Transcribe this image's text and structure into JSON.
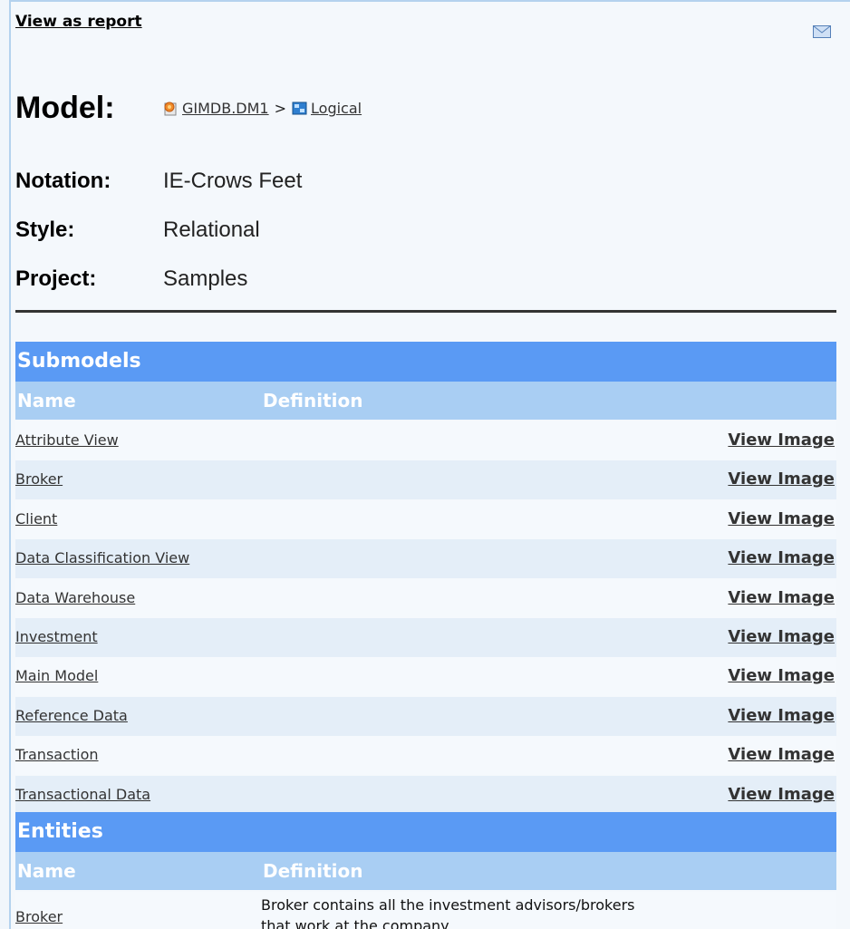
{
  "header": {
    "view_as_report": "View as report",
    "mail_icon": "mail-icon"
  },
  "model": {
    "label": "Model:",
    "breadcrumb": {
      "model_link": "GIMDB.DM1",
      "separator": ">",
      "submodel_link": "Logical"
    }
  },
  "properties": {
    "notation": {
      "label": "Notation:",
      "value": "IE-Crows Feet"
    },
    "style": {
      "label": "Style:",
      "value": "Relational"
    },
    "project": {
      "label": "Project:",
      "value": "Samples"
    }
  },
  "submodels": {
    "title": "Submodels",
    "columns": {
      "name": "Name",
      "definition": "Definition"
    },
    "view_image_label": "View Image",
    "rows": [
      {
        "name": "Attribute View"
      },
      {
        "name": "Broker"
      },
      {
        "name": "Client"
      },
      {
        "name": "Data Classification View"
      },
      {
        "name": "Data Warehouse"
      },
      {
        "name": "Investment"
      },
      {
        "name": "Main Model"
      },
      {
        "name": "Reference Data"
      },
      {
        "name": "Transaction"
      },
      {
        "name": "Transactional Data"
      }
    ]
  },
  "entities": {
    "title": "Entities",
    "columns": {
      "name": "Name",
      "definition": "Definition"
    },
    "rows": [
      {
        "name": "Broker",
        "definition": "Broker contains all the investment advisors/brokers that work at the company."
      }
    ]
  },
  "colors": {
    "section_header": "#5a9af4",
    "column_header": "#a9cef3",
    "row_alt": "#e4eef8",
    "background": "#f4f8fc"
  }
}
